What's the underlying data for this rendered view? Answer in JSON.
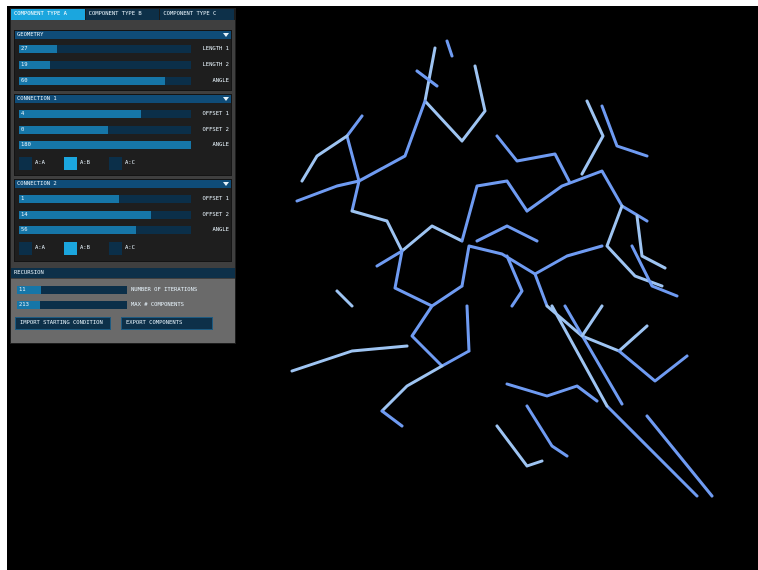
{
  "tabs": [
    {
      "label": "COMPONENT TYPE A",
      "active": true
    },
    {
      "label": "COMPONENT TYPE B",
      "active": false
    },
    {
      "label": "COMPONENT TYPE C",
      "active": false
    }
  ],
  "geometry": {
    "title": "GEOMETRY",
    "sliders": [
      {
        "value": "27",
        "label": "LENGTH 1",
        "fill": 0.22
      },
      {
        "value": "19",
        "label": "LENGTH 2",
        "fill": 0.18
      },
      {
        "value": "60",
        "label": "ANGLE",
        "fill": 0.85
      }
    ]
  },
  "connection1": {
    "title": "CONNECTION 1",
    "sliders": [
      {
        "value": "4",
        "label": "OFFSET 1",
        "fill": 0.71
      },
      {
        "value": "0",
        "label": "OFFSET 2",
        "fill": 0.52
      },
      {
        "value": "180",
        "label": "ANGLE",
        "fill": 1.0
      }
    ],
    "options": [
      {
        "label": "A:A",
        "selected": false
      },
      {
        "label": "A:B",
        "selected": true
      },
      {
        "label": "A:C",
        "selected": false
      }
    ]
  },
  "connection2": {
    "title": "CONNECTION 2",
    "sliders": [
      {
        "value": "1",
        "label": "OFFSET 1",
        "fill": 0.58
      },
      {
        "value": "14",
        "label": "OFFSET 2",
        "fill": 0.77
      },
      {
        "value": "56",
        "label": "ANGLE",
        "fill": 0.68
      }
    ],
    "options": [
      {
        "label": "A:A",
        "selected": false
      },
      {
        "label": "A:B",
        "selected": true
      },
      {
        "label": "A:C",
        "selected": false
      }
    ]
  },
  "recursion": {
    "title": "RECURSION",
    "iterations": {
      "value": "11",
      "label": "NUMBER OF ITERATIONS",
      "fill": 0.22
    },
    "max_components": {
      "value": "213",
      "label": "MAX # COMPONENTS",
      "fill": 0.21
    },
    "import_label": "IMPORT STARTING CONDITION",
    "export_label": "EXPORT COMPONENTS"
  },
  "colors": {
    "accent": "#1ba6de",
    "panel": "#3f3f3f",
    "section_header": "#0f4c78",
    "slider_bg": "#0b2f49",
    "slider_fill": "#1676a8",
    "component": "#6f9bf2",
    "component_light": "#9ec4f2"
  }
}
